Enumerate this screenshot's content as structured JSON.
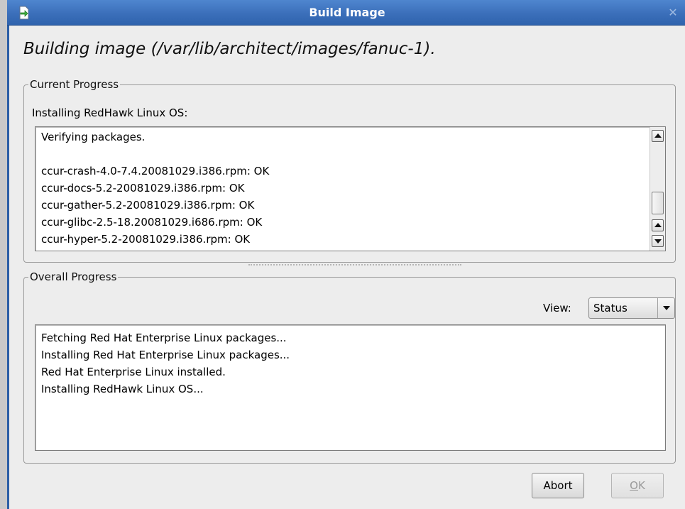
{
  "window": {
    "title": "Build Image",
    "close_glyph": "✕",
    "title_icon": "document-arrow-icon"
  },
  "headline": "Building image (/var/lib/architect/images/fanuc-1).",
  "current_progress": {
    "legend": "Current Progress",
    "label": "Installing RedHawk Linux OS:",
    "log_lines": [
      "Verifying packages.",
      "",
      "ccur-crash-4.0-7.4.20081029.i386.rpm: OK",
      "ccur-docs-5.2-20081029.i386.rpm: OK",
      "ccur-gather-5.2-20081029.i386.rpm: OK",
      "ccur-glibc-2.5-18.20081029.i686.rpm: OK",
      "ccur-hyper-5.2-20081029.i386.rpm: OK"
    ]
  },
  "overall_progress": {
    "legend": "Overall Progress",
    "view_label": "View:",
    "view_selected": "Status",
    "status_lines": [
      "Fetching Red Hat Enterprise Linux packages...",
      "Installing Red Hat Enterprise Linux packages...",
      "Red Hat Enterprise Linux installed.",
      "Installing RedHawk Linux OS..."
    ]
  },
  "buttons": {
    "abort": "Abort",
    "ok_mnemonic": "O",
    "ok_rest": "K"
  },
  "colors": {
    "titlebar": "#3b6fba",
    "window_bg": "#ededed"
  }
}
